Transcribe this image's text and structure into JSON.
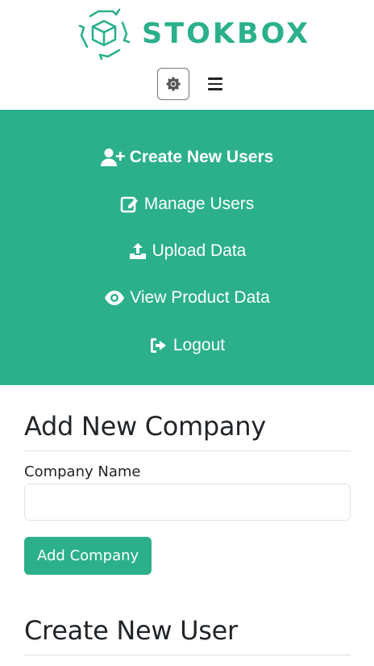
{
  "brand": {
    "name": "STOKBOX",
    "color": "#2bb08b"
  },
  "toolbar": {
    "settings_icon": "gear-icon",
    "menu_icon": "hamburger-icon"
  },
  "nav": {
    "items": [
      {
        "label": "Create New Users",
        "icon": "user-plus-icon",
        "active": true
      },
      {
        "label": "Manage Users",
        "icon": "edit-icon"
      },
      {
        "label": "Upload Data",
        "icon": "upload-icon"
      },
      {
        "label": "View Product Data",
        "icon": "eye-icon"
      },
      {
        "label": "Logout",
        "icon": "logout-icon"
      }
    ]
  },
  "company_form": {
    "title": "Add New Company",
    "name_label": "Company Name",
    "name_value": "",
    "submit_label": "Add Company"
  },
  "user_form": {
    "title": "Create New User"
  }
}
